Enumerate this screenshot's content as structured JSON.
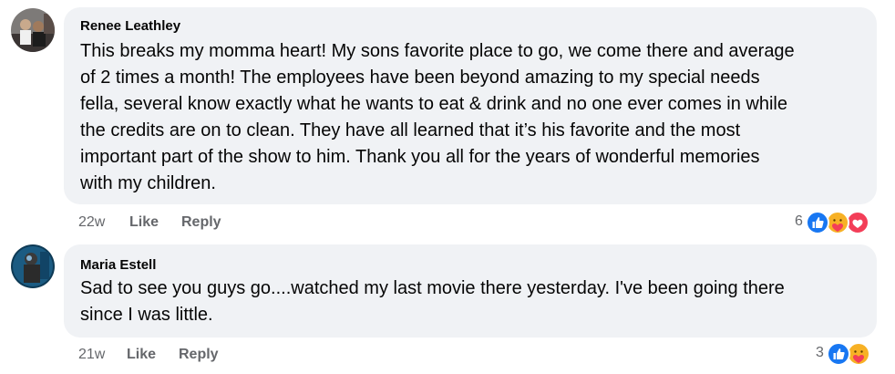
{
  "comments": [
    {
      "author": "Renee Leathley",
      "lines": [
        "This breaks my momma heart! My sons favorite place to go, we come there and average",
        "of 2 times a month! The employees have been beyond amazing to my special needs",
        "fella, several know exactly what he wants to eat & drink and no one ever comes in while",
        "the credits are on to clean. They have all learned that it’s his favorite and the most",
        "important part of the show to him. Thank you all for the years of wonderful memories",
        "with my children."
      ],
      "time": "22w",
      "like_label": "Like",
      "reply_label": "Reply",
      "reaction_count": "6",
      "reactions": [
        "like-icon",
        "care-icon",
        "love-icon"
      ]
    },
    {
      "author": "Maria Estell",
      "lines": [
        "Sad to see you guys go....watched my last movie there yesterday. I've been going there",
        "since I was little."
      ],
      "time": "21w",
      "like_label": "Like",
      "reply_label": "Reply",
      "reaction_count": "3",
      "reactions": [
        "like-icon",
        "care-icon"
      ]
    }
  ],
  "colors": {
    "bubble": "#f0f2f5",
    "meta": "#65676b",
    "like": "#1877f2",
    "love": "#f33e58",
    "care": "#f7b125"
  }
}
